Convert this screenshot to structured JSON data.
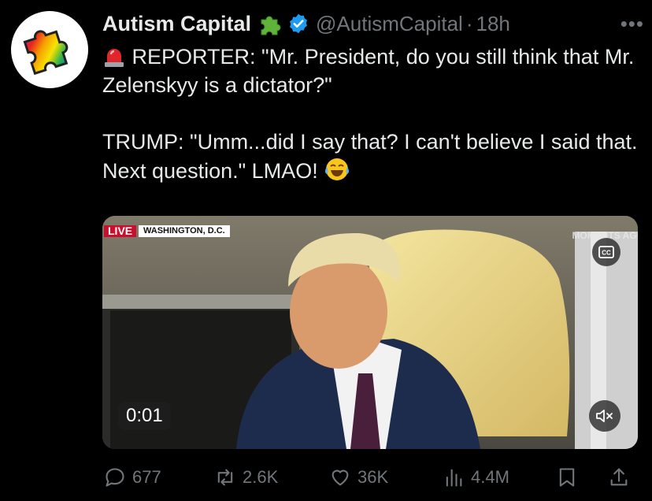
{
  "author": {
    "display_name": "Autism Capital",
    "handle": "@AutismCapital",
    "separator": "·",
    "time": "18h",
    "more_icon": "more-icon",
    "verified_color": "#1d9bf0"
  },
  "tweet": {
    "line1": "REPORTER: \"Mr. President, do you still think that Mr. Zelenskyy is a dictator?\"",
    "line2": "TRUMP: \"Umm...did I say that? I can't believe I said that. Next question.\" LMAO!"
  },
  "media": {
    "live_label": "LIVE",
    "location_label": "WASHINGTON, D.C.",
    "moments_label": "MOMENTS AGO",
    "cc_label": "CC",
    "timestamp": "0:01"
  },
  "actions": {
    "replies": "677",
    "reposts": "2.6K",
    "likes": "36K",
    "views": "4.4M"
  }
}
